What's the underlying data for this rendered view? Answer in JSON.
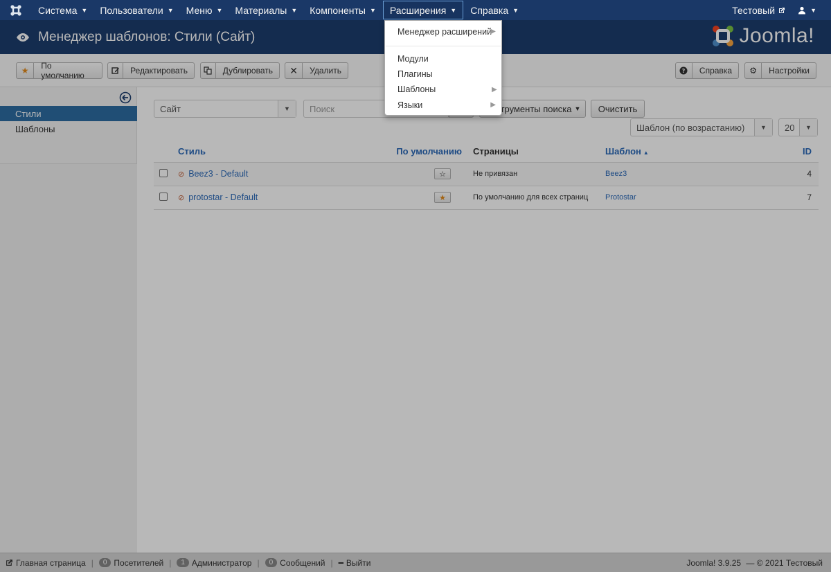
{
  "nav": {
    "items": [
      {
        "label": "Система"
      },
      {
        "label": "Пользователи"
      },
      {
        "label": "Меню"
      },
      {
        "label": "Материалы"
      },
      {
        "label": "Компоненты"
      },
      {
        "label": "Расширения"
      },
      {
        "label": "Справка"
      }
    ],
    "site_name": "Тестовый",
    "user_icon": "user-icon"
  },
  "header": {
    "title": "Менеджер шаблонов: Стили (Сайт)",
    "brand": "Joomla!"
  },
  "toolbar": {
    "default": "По умолчанию",
    "edit": "Редактировать",
    "duplicate": "Дублировать",
    "delete": "Удалить",
    "help": "Справка",
    "settings": "Настройки"
  },
  "sidebar": {
    "items": [
      {
        "label": "Стили",
        "active": true
      },
      {
        "label": "Шаблоны",
        "active": false
      }
    ]
  },
  "filters": {
    "client": "Сайт",
    "search_placeholder": "Поиск",
    "search_tools": "Инструменты поиска",
    "clear": "Очистить",
    "ordering": "Шаблон (по возрастанию)",
    "limit": "20"
  },
  "table": {
    "headers": {
      "style": "Стиль",
      "default": "По умолчанию",
      "pages": "Страницы",
      "template": "Шаблон",
      "id": "ID"
    },
    "rows": [
      {
        "style": "Beez3 - Default",
        "is_default": false,
        "pages": "Не привязан",
        "template": "Beez3",
        "id": "4"
      },
      {
        "style": "protostar - Default",
        "is_default": true,
        "pages": "По умолчанию для всех страниц",
        "template": "Protostar",
        "id": "7"
      }
    ]
  },
  "dropdown": {
    "items": [
      {
        "label": "Менеджер расширений",
        "submenu": true
      },
      {
        "label": "Модули",
        "submenu": false
      },
      {
        "label": "Плагины",
        "submenu": false
      },
      {
        "label": "Шаблоны",
        "submenu": true
      },
      {
        "label": "Языки",
        "submenu": true
      }
    ]
  },
  "footer": {
    "home": "Главная страница",
    "visitors_count": "0",
    "visitors": "Посетителей",
    "admins_count": "1",
    "admins": "Администратор",
    "messages_count": "0",
    "messages": "Сообщений",
    "logout": "Выйти",
    "version": "Joomla! 3.9.25",
    "copyright": "— © 2021 Тестовый"
  },
  "colors": {
    "navbar": "#1a3867",
    "subhead": "#1c3d6e",
    "link": "#2a69b8",
    "sidebar_active": "#2d6ca2",
    "star": "#e28a1a"
  }
}
